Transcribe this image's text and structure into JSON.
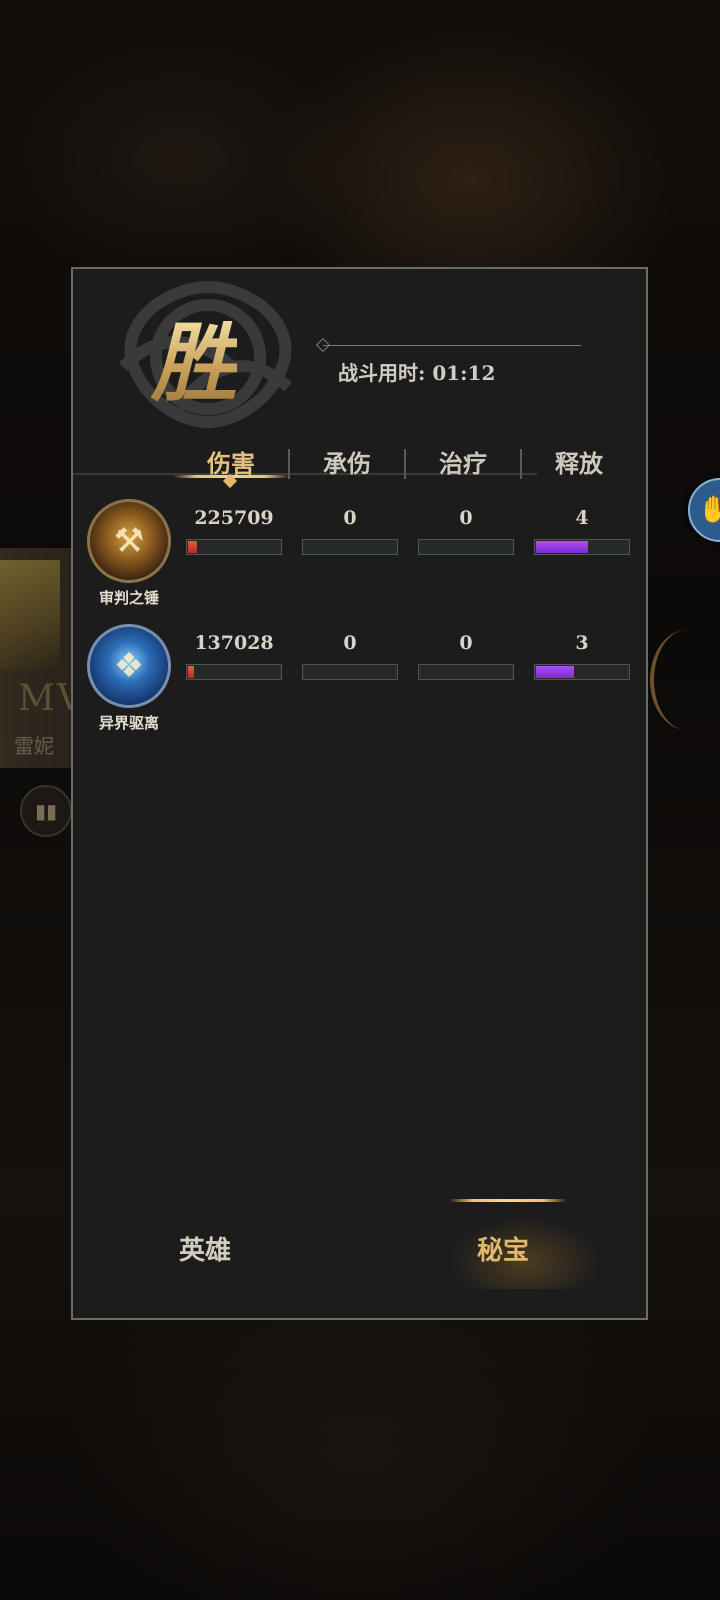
{
  "result": {
    "title": "胜",
    "timer_label": "战斗用时: 01:12"
  },
  "tabs": [
    {
      "label": "伤害",
      "active": true
    },
    {
      "label": "承伤",
      "active": false
    },
    {
      "label": "治疗",
      "active": false
    },
    {
      "label": "释放",
      "active": false
    }
  ],
  "heroes": [
    {
      "name": "审判之锤",
      "damage": "225709",
      "damage_fill": 0.12,
      "taken": "0",
      "taken_fill": 0,
      "heal": "0",
      "heal_fill": 0,
      "casts": "4",
      "casts_fill": 0.57,
      "icon": "hammer-icon"
    },
    {
      "name": "异界驱离",
      "damage": "137028",
      "damage_fill": 0.08,
      "taken": "0",
      "taken_fill": 0,
      "heal": "0",
      "heal_fill": 0,
      "casts": "3",
      "casts_fill": 0.43,
      "icon": "crystal-icon"
    }
  ],
  "bottom_tabs": {
    "heroes": "英雄",
    "treasures": "秘宝",
    "active": "treasures"
  },
  "background": {
    "mvp_text": "MV",
    "sub_text": "雷妮",
    "chart_icon": "bar-chart-icon"
  },
  "colors": {
    "gold": "#e2c27e",
    "damage_bar": "#c93a26",
    "casts_bar": "#9a3ce6",
    "side_button": "#2d5c8c"
  }
}
